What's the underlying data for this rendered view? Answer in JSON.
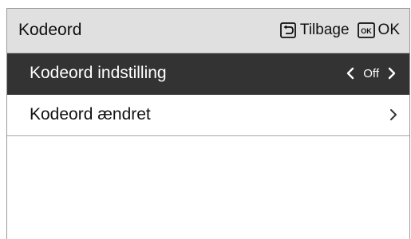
{
  "header": {
    "title": "Kodeord",
    "back_label": "Tilbage",
    "ok_icon_text": "OK",
    "ok_label": "OK",
    "back_icon": "back-arrow-icon"
  },
  "menu": {
    "items": [
      {
        "label": "Kodeord indstilling",
        "value": "Off",
        "selected": true,
        "left_icon": "chevron-left-icon",
        "right_icon": "chevron-right-icon"
      },
      {
        "label": "Kodeord ændret",
        "selected": false,
        "right_icon": "chevron-right-icon"
      }
    ]
  },
  "colors": {
    "header_bg": "#e0e0e0",
    "selected_row_bg": "#333333",
    "selected_text": "#ffffff",
    "text": "#111111",
    "border": "#9a9a9a"
  }
}
